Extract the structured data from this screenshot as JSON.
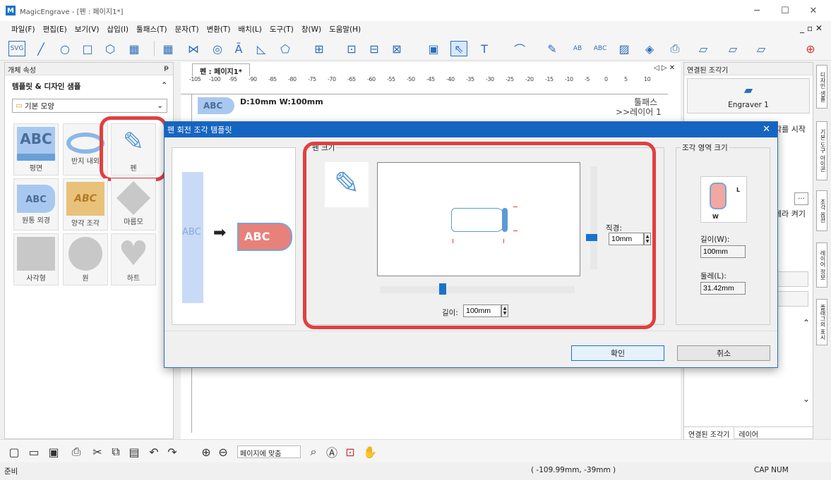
{
  "window": {
    "app_title": "MagicEngrave - [펜 : 페이지1*]",
    "minimize": "─",
    "maximize": "☐",
    "close": "✕"
  },
  "menu": {
    "items": [
      "파일(F)",
      "편집(E)",
      "보기(V)",
      "삽입(I)",
      "툴패스(T)",
      "문자(T)",
      "변환(T)",
      "배치(L)",
      "도구(T)",
      "창(W)",
      "도움말(H)"
    ],
    "right_controls": "_ ▫ ✕"
  },
  "left_panel": {
    "header": "개체 속성",
    "pin": "ᵽ",
    "section_title": "템플릿 & 디자인 샘플",
    "collapse": "⌃",
    "combo_value": "기본 모양",
    "tiles": [
      {
        "label": "평면"
      },
      {
        "label": "반지 내외"
      },
      {
        "label": "펜"
      },
      {
        "label": "원통 외경"
      },
      {
        "label": "양각 조각"
      },
      {
        "label": "마름모"
      },
      {
        "label": "사각형"
      },
      {
        "label": "원"
      },
      {
        "label": "하트"
      }
    ]
  },
  "editor": {
    "tab": "펜 : 페이지1*",
    "nav": "◁ ▷ ✕",
    "dimension_text": "D:10mm  W:100mm",
    "abc": "ABC",
    "toolpath": "툴패스",
    "layer": ">>레이어 1",
    "ruler_ticks": [
      "-105",
      "-100",
      "-95",
      "-90",
      "-85",
      "-80",
      "-75",
      "-70",
      "-65",
      "-60",
      "-55",
      "-50",
      "-45",
      "-40",
      "-35",
      "-30",
      "-25",
      "-20",
      "-15",
      "-10",
      "-5",
      "0",
      "5",
      "10"
    ]
  },
  "right_panel": {
    "header": "연결된 조각기",
    "device": "Engraver 1",
    "partial_start": "각를 시작",
    "partial_camera": "메라 켜기",
    "ellipsis": "...",
    "tabs": [
      "연결된 조각기",
      "레이어"
    ]
  },
  "sidebar": {
    "tabs": [
      "디자인 샘플",
      "기본 도구 아이콘",
      "조각 옵션",
      "레이어 정보",
      "플래그의 표시"
    ]
  },
  "dialog": {
    "title": "펜 회전 조각 템플릿",
    "close": "✕",
    "abc": "ABC",
    "pen_size_group": "펜 크기",
    "diameter_label": "직경:",
    "diameter_value": "10mm",
    "length_label": "길이:",
    "length_value": "100mm",
    "area_group": "조각 영역 크기",
    "area_length_label": "길이(W):",
    "area_length_value": "100mm",
    "area_circ_label": "둘레(L):",
    "area_circ_value": "31.42mm",
    "ok": "확인",
    "cancel": "취소",
    "w_mark": "W",
    "l_mark": "L"
  },
  "status_tools": {
    "fit": "페이지에 맞춤"
  },
  "status": {
    "ready": "준비",
    "coords": "( -109.99mm, -39mm )",
    "caps": "CAP  NUM"
  },
  "colors": {
    "accent": "#1565c0",
    "highlight": "#e04040",
    "pen": "#5b9bd5"
  }
}
